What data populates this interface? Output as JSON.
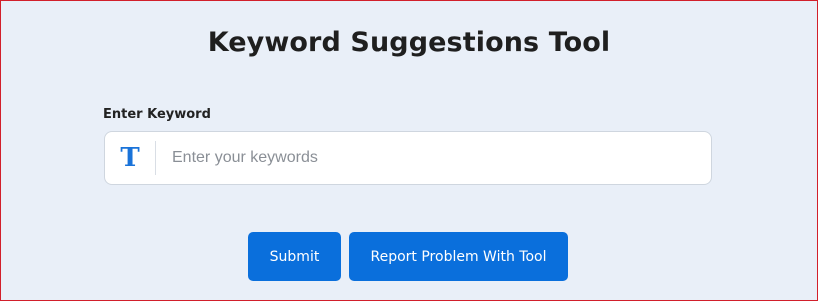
{
  "page": {
    "title": "Keyword Suggestions Tool"
  },
  "form": {
    "label": "Enter Keyword",
    "input_icon": "T",
    "input_icon_name": "text-type-icon",
    "placeholder": "Enter your keywords",
    "value": ""
  },
  "buttons": {
    "submit_label": "Submit",
    "report_label": "Report Problem With Tool"
  },
  "colors": {
    "background": "#e9eff8",
    "accent": "#0a6fdc",
    "icon": "#1a73d9",
    "frame_border": "#d21f2b"
  }
}
